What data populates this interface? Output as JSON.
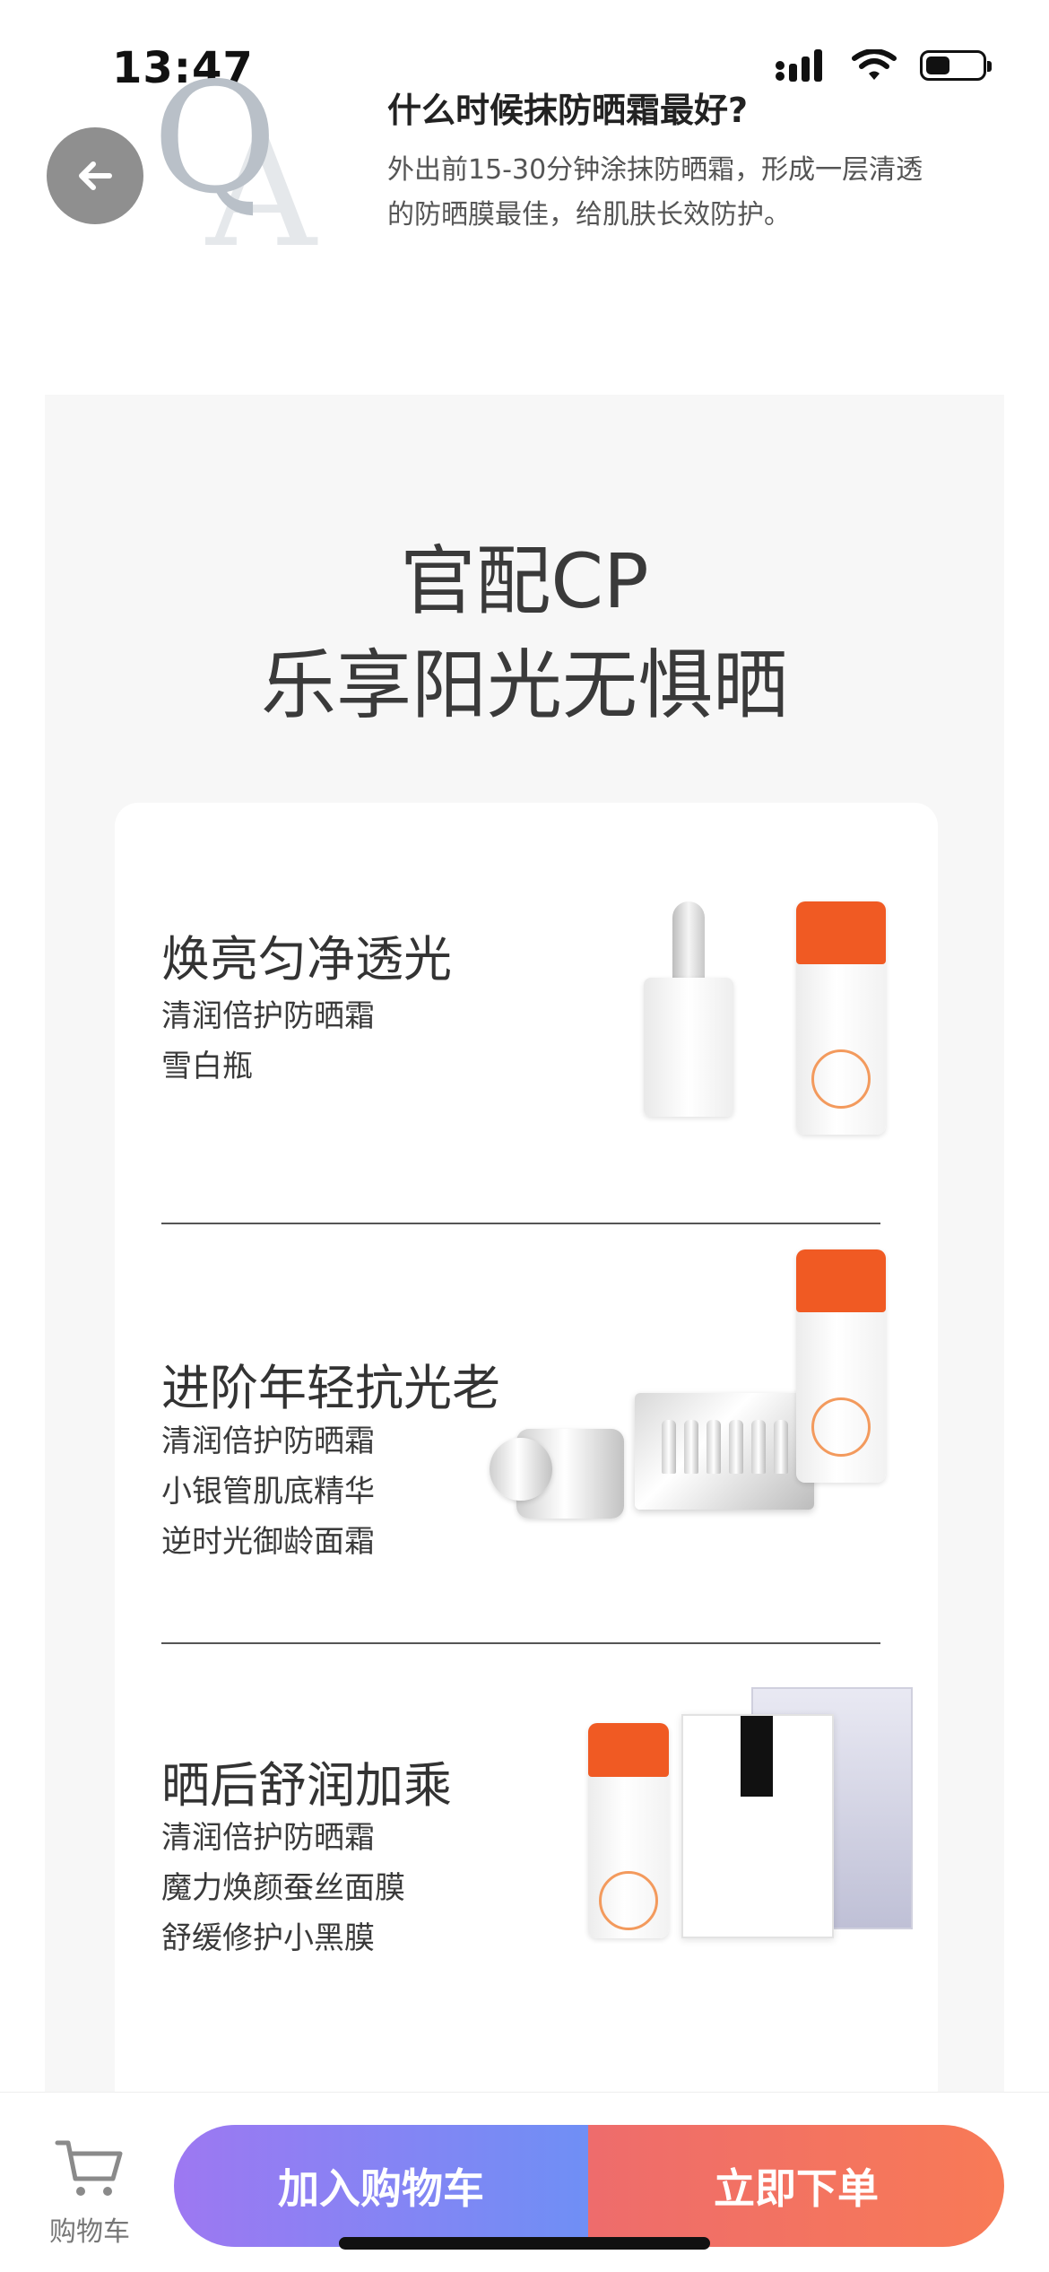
{
  "status_bar": {
    "time": "13:47"
  },
  "qa": {
    "mark_q": "Q",
    "mark_a": "A",
    "question": "什么时候抹防晒霜最好?",
    "answer": "外出前15-30分钟涂抹防晒霜，形成一层清透的防晒膜最佳，给肌肤长效防护。"
  },
  "panel": {
    "title_line1": "官配CP",
    "title_line2": "乐享阳光无惧晒"
  },
  "combos": [
    {
      "title": "焕亮匀净透光",
      "items": [
        "清润倍护防晒霜",
        "雪白瓶"
      ]
    },
    {
      "title": "进阶年轻抗光老",
      "items": [
        "清润倍护防晒霜",
        "小银管肌底精华",
        "逆时光御龄面霜"
      ]
    },
    {
      "title": "晒后舒润加乘",
      "items": [
        "清润倍护防晒霜",
        "魔力焕颜蚕丝面膜",
        "舒缓修护小黑膜"
      ]
    }
  ],
  "bottom_bar": {
    "cart_label": "购物车",
    "add_to_cart": "加入购物车",
    "buy_now": "立即下单"
  },
  "colors": {
    "cart_gradient": [
      "#9d78f2",
      "#6f8ff5"
    ],
    "buy_gradient": [
      "#ee6c6c",
      "#f87a56"
    ],
    "sunscreen_cap": "#f05a23"
  }
}
